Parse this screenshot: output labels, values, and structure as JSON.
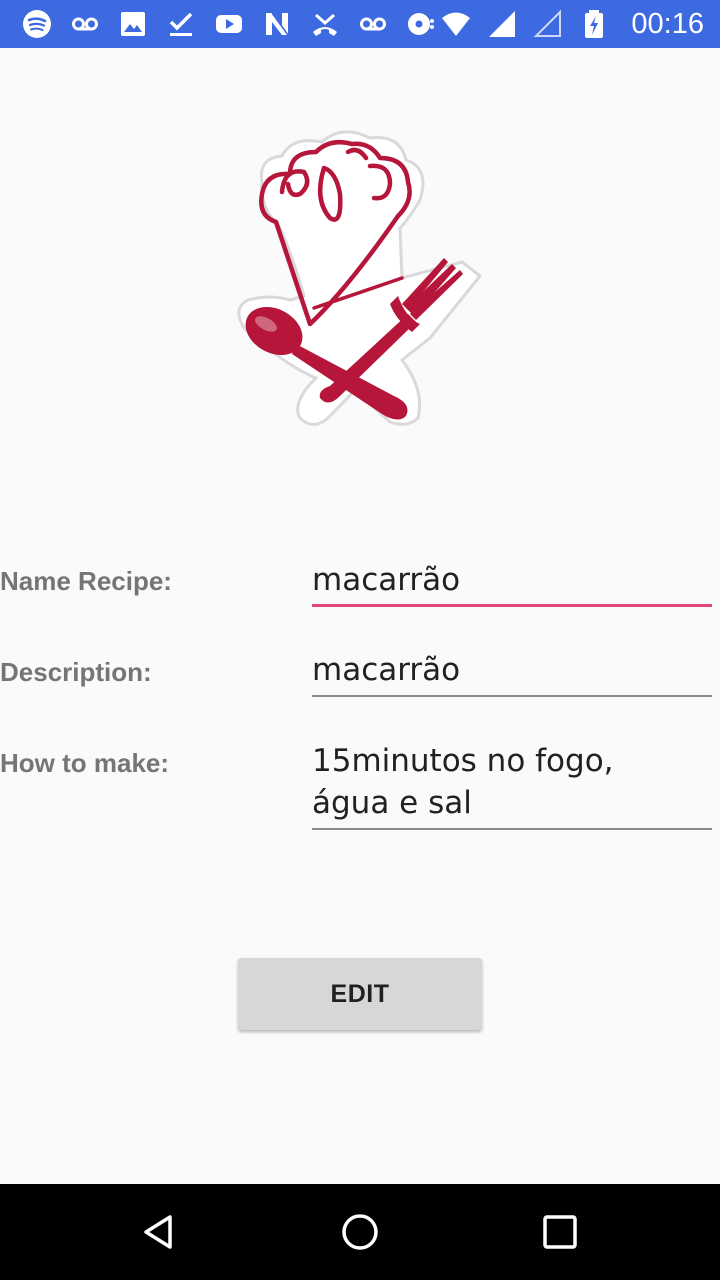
{
  "status_bar": {
    "time": "00:16",
    "color": "#3d6ae0",
    "left_icons": [
      "spotify-icon",
      "voicemail-icon",
      "image-icon",
      "task-done-icon",
      "youtube-icon",
      "n-app-icon",
      "missed-call-icon",
      "voicemail-icon",
      "disc-sync-icon"
    ],
    "right_icons": [
      "wifi-icon",
      "signal-icon",
      "signal-empty-icon",
      "battery-charging-icon"
    ]
  },
  "logo": {
    "name": "chef-hat-spoon-fork-logo",
    "accent": "#b5163a"
  },
  "form": {
    "name_recipe": {
      "label": "Name Recipe:",
      "value": "macarrão",
      "focused": true
    },
    "description": {
      "label": "Description:",
      "value": "macarrão"
    },
    "how_to_make": {
      "label": "How to make:",
      "value": "15minutos no fogo,\nágua e sal",
      "line1": "15minutos no fogo,",
      "line2": "água e sal"
    }
  },
  "edit_button": {
    "label": "EDIT"
  },
  "accent_color": "#e0457b",
  "nav_bar": {
    "buttons": [
      "back-icon",
      "home-icon",
      "recents-icon"
    ]
  }
}
